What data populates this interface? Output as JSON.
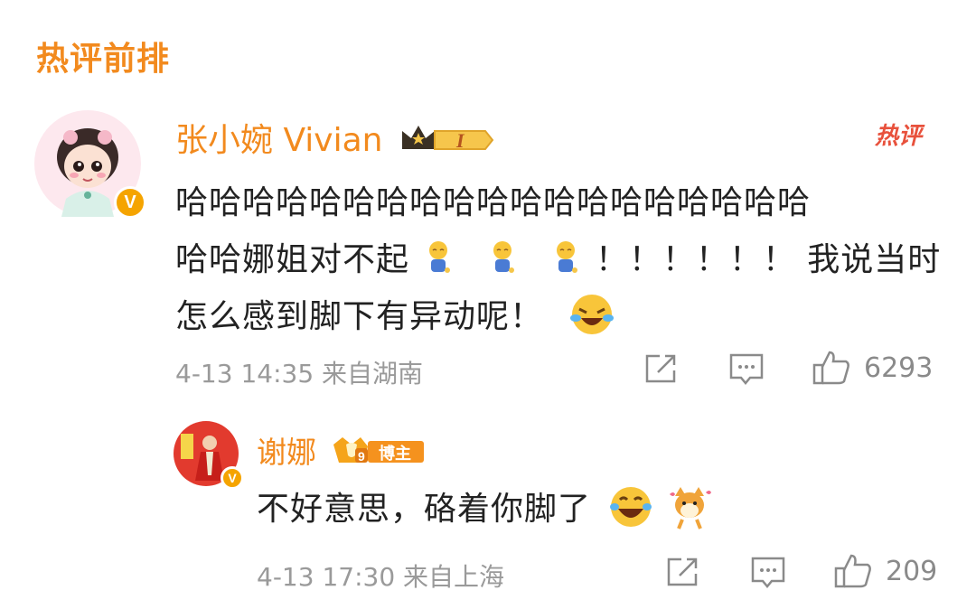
{
  "section_title": "热评前排",
  "comments": [
    {
      "username": "张小婉 Vivian",
      "level_badge": "I",
      "hot_tag": "热评",
      "text_line1": "哈哈哈哈哈哈哈哈哈哈哈哈哈哈哈哈哈哈哈",
      "text_line2a": "哈哈娜姐对不起",
      "text_line2b": "！！！！！！ 我说当时",
      "text_line3": "怎么感到脚下有异动呢！",
      "meta": "4-13 14:35  来自湖南",
      "like_count": "6293"
    },
    {
      "username": "谢娜",
      "badge_label": "博主",
      "badge_level": "9",
      "text": "不好意思，硌着你脚了",
      "meta": "4-13 17:30  来自上海",
      "like_count": "209"
    }
  ],
  "icons": {
    "share": "share-icon",
    "comment": "comment-icon",
    "like": "thumbs-up-icon",
    "verified": "verified-v-icon",
    "crown": "crown-icon"
  },
  "colors": {
    "accent": "#f28a1e",
    "hot": "#e8513c",
    "text": "#222222",
    "meta": "#9a9a9a"
  }
}
